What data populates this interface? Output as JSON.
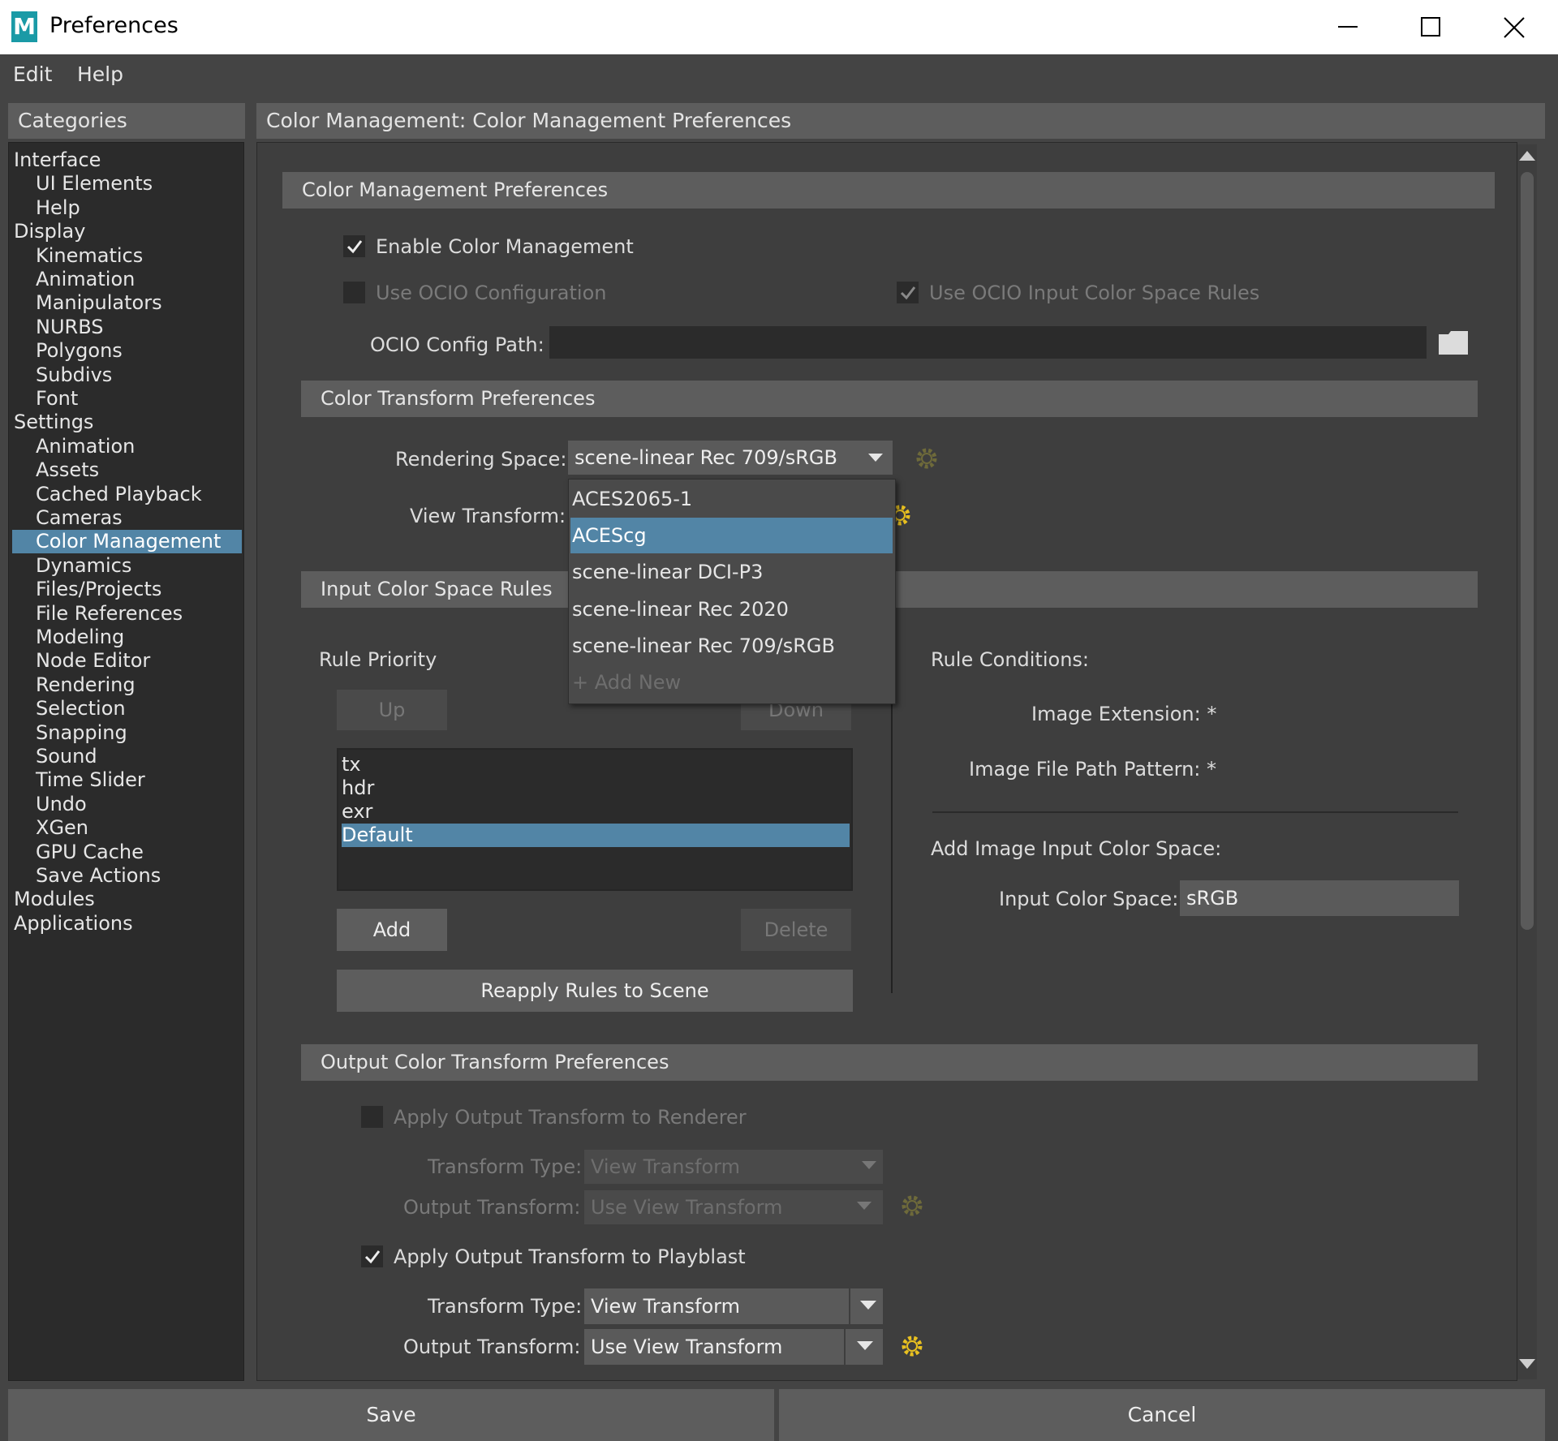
{
  "window": {
    "title": "Preferences",
    "logo": "M"
  },
  "menu": [
    "Edit",
    "Help"
  ],
  "categories_header": "Categories",
  "categories": [
    {
      "label": "Interface",
      "sub": false
    },
    {
      "label": "UI Elements",
      "sub": true
    },
    {
      "label": "Help",
      "sub": true
    },
    {
      "label": "Display",
      "sub": false
    },
    {
      "label": "Kinematics",
      "sub": true
    },
    {
      "label": "Animation",
      "sub": true
    },
    {
      "label": "Manipulators",
      "sub": true
    },
    {
      "label": "NURBS",
      "sub": true
    },
    {
      "label": "Polygons",
      "sub": true
    },
    {
      "label": "Subdivs",
      "sub": true
    },
    {
      "label": "Font",
      "sub": true
    },
    {
      "label": "Settings",
      "sub": false
    },
    {
      "label": "Animation",
      "sub": true
    },
    {
      "label": "Assets",
      "sub": true
    },
    {
      "label": "Cached Playback",
      "sub": true
    },
    {
      "label": "Cameras",
      "sub": true
    },
    {
      "label": "Color Management",
      "sub": true,
      "selected": true
    },
    {
      "label": "Dynamics",
      "sub": true
    },
    {
      "label": "Files/Projects",
      "sub": true
    },
    {
      "label": "File References",
      "sub": true
    },
    {
      "label": "Modeling",
      "sub": true
    },
    {
      "label": "Node Editor",
      "sub": true
    },
    {
      "label": "Rendering",
      "sub": true
    },
    {
      "label": "Selection",
      "sub": true
    },
    {
      "label": "Snapping",
      "sub": true
    },
    {
      "label": "Sound",
      "sub": true
    },
    {
      "label": "Time Slider",
      "sub": true
    },
    {
      "label": "Undo",
      "sub": true
    },
    {
      "label": "XGen",
      "sub": true
    },
    {
      "label": "GPU Cache",
      "sub": true
    },
    {
      "label": "Save Actions",
      "sub": true
    },
    {
      "label": "Modules",
      "sub": false
    },
    {
      "label": "Applications",
      "sub": false
    }
  ],
  "content_header": "Color Management: Color Management Preferences",
  "cm": {
    "section_title": "Color Management Preferences",
    "enable_label": "Enable Color Management",
    "enable_checked": true,
    "use_ocio_label": "Use OCIO Configuration",
    "use_ocio_checked": false,
    "use_ocio_rules_label": "Use OCIO Input Color Space Rules",
    "use_ocio_rules_checked": true,
    "ocio_path_label": "OCIO Config Path:",
    "ocio_path_value": ""
  },
  "transform": {
    "section_title": "Color Transform Preferences",
    "rendering_space_label": "Rendering Space:",
    "rendering_space_value": "scene-linear Rec 709/sRGB",
    "view_transform_label": "View Transform:",
    "dropdown_options": [
      "ACES2065-1",
      "ACEScg",
      "scene-linear DCI-P3",
      "scene-linear Rec 2020",
      "scene-linear Rec 709/sRGB",
      "+ Add New"
    ],
    "dropdown_highlighted": "ACEScg"
  },
  "rules": {
    "section_title": "Input Color Space Rules",
    "priority_label": "Rule Priority",
    "up_label": "Up",
    "down_label": "Down",
    "items": [
      "tx",
      "hdr",
      "exr",
      "Default"
    ],
    "selected_item": "Default",
    "add_label": "Add",
    "delete_label": "Delete",
    "reapply_label": "Reapply Rules to Scene",
    "conditions_label": "Rule Conditions:",
    "image_extension": "Image Extension: *",
    "image_path_pattern": "Image File Path Pattern: *",
    "add_input_label": "Add Image Input Color Space:",
    "input_cs_label": "Input Color Space:",
    "input_cs_value": "sRGB"
  },
  "output": {
    "section_title": "Output Color Transform Preferences",
    "renderer_label": "Apply Output Transform to Renderer",
    "renderer_checked": false,
    "transform_type_label": "Transform Type:",
    "transform_type_value": "View Transform",
    "output_transform_label": "Output Transform:",
    "output_transform_value": "Use View Transform",
    "playblast_label": "Apply Output Transform to Playblast",
    "playblast_checked": true,
    "pb_transform_type_value": "View Transform",
    "pb_output_transform_value": "Use View Transform"
  },
  "footer": {
    "save_label": "Save",
    "cancel_label": "Cancel"
  },
  "colors": {
    "accent": "#5285a6",
    "panel": "#444444",
    "header": "#5d5d5d",
    "field": "#2b2b2b"
  }
}
